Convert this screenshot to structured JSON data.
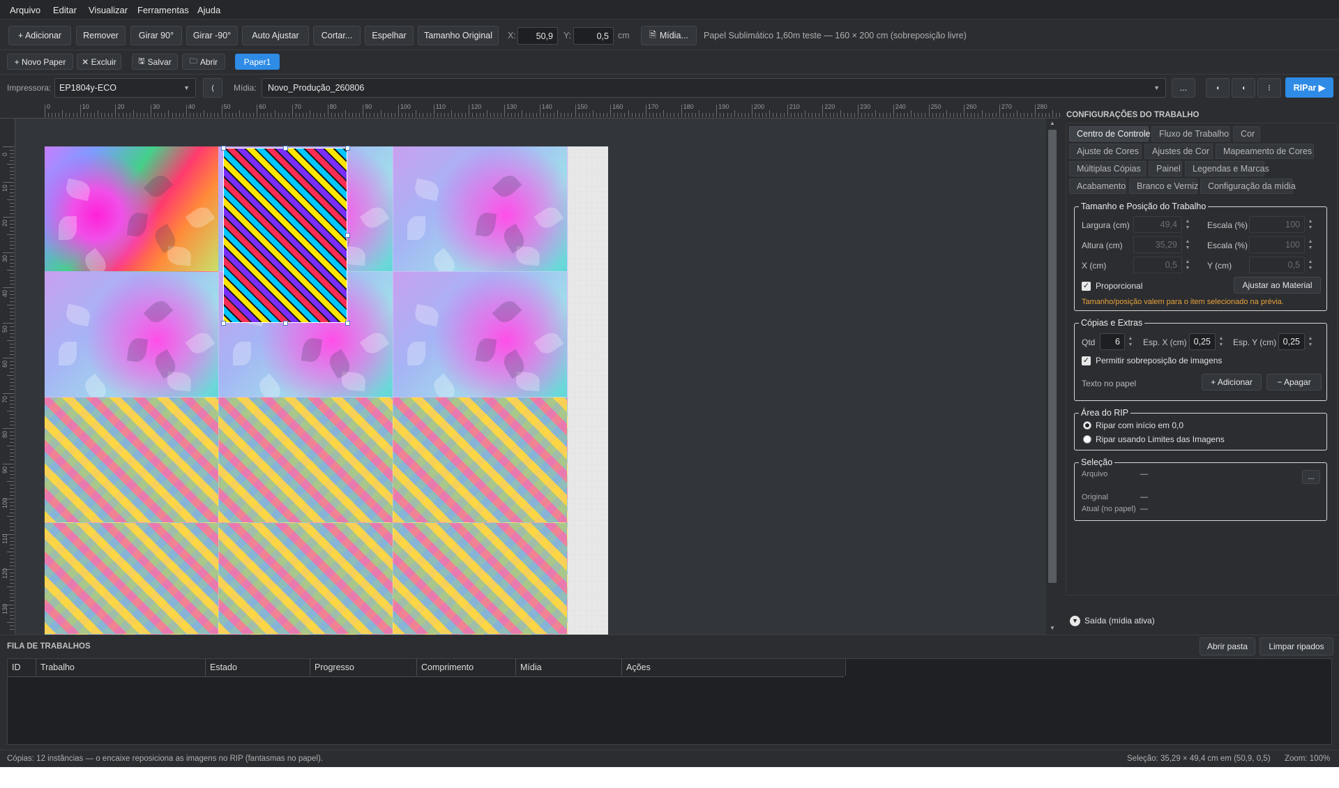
{
  "menu": [
    "Arquivo",
    "Editar",
    "Visualizar",
    "Ferramentas",
    "Ajuda"
  ],
  "toolbar": {
    "add": "+ Adicionar",
    "remove": "Remover",
    "rot90": "Girar 90°",
    "rotm90": "Girar -90°",
    "autofit": "Auto Ajustar",
    "cut": "Cortar...",
    "mirror": "Espelhar",
    "original": "Tamanho Original",
    "x_label": "X:",
    "x_value": "50,9",
    "y_label": "Y:",
    "y_value": "0,5",
    "unit": "cm",
    "media_btn": "Mídia...",
    "info": "Papel Sublimático 1,60m teste — 160 × 200 cm  (sobreposição livre)"
  },
  "papers": {
    "new": "+ Novo Paper",
    "delete": "✕ Excluir",
    "save": "Salvar",
    "open": "Abrir",
    "tab": "Paper1"
  },
  "printer": {
    "label": "Impressora:",
    "value": "EP1804y-ECO",
    "media_label": "Mídia:",
    "media_value": "Novo_Produção_260806",
    "more": "...",
    "rip": "RIPar ▶"
  },
  "ruler": {
    "unit": "cm",
    "h": [
      "0",
      "10",
      "20",
      "30",
      "40",
      "50",
      "60",
      "70",
      "80",
      "90",
      "100",
      "110",
      "120",
      "130",
      "140",
      "150",
      "160",
      "170",
      "180",
      "190",
      "200",
      "210",
      "220",
      "230",
      "240",
      "250",
      "260",
      "270",
      "280"
    ],
    "v": [
      "0",
      "10",
      "20",
      "30",
      "40",
      "50",
      "60",
      "70",
      "80",
      "90",
      "100",
      "110",
      "120",
      "130"
    ]
  },
  "panel": {
    "title": "CONFIGURAÇÕES DO TRABALHO",
    "tabs_row1": [
      "Centro de Controle",
      "Fluxo de Trabalho",
      "Cor"
    ],
    "tabs_row2": [
      "Ajuste de Cores",
      "Ajustes de Cor",
      "Mapeamento de Cores"
    ],
    "tabs_row3": [
      "Múltiplas Cópias",
      "Painel",
      "Legendas e Marcas"
    ],
    "tabs_row4": [
      "Acabamento",
      "Branco e Verniz",
      "Configuração da mídia"
    ],
    "size": {
      "title": "Tamanho e Posição do Trabalho",
      "width_label": "Largura (cm)",
      "width": "49,4",
      "height_label": "Altura (cm)",
      "height": "35,29",
      "x_label": "X (cm)",
      "x": "0,5",
      "scale_label": "Escala (%)",
      "scale1": "100",
      "scale2": "100",
      "y_label": "Y (cm)",
      "y": "0,5",
      "proportional": "Proporcional",
      "fit": "Ajustar ao Material",
      "warning": "Tamanho/posição valem para o item selecionado na prévia."
    },
    "copies": {
      "title": "Cópias e Extras",
      "qty_label": "Qtd",
      "qty": "6",
      "espx_label": "Esp. X (cm)",
      "espx": "0,25",
      "espy_label": "Esp. Y (cm)",
      "espy": "0,25",
      "overlap": "Permitir sobreposição de imagens",
      "text_label": "Texto no papel",
      "add": "+ Adicionar",
      "erase": "− Apagar"
    },
    "rip": {
      "title": "Área do RIP",
      "opt1": "Ripar com início em 0,0",
      "opt2": "Ripar usando Limites das Imagens"
    },
    "selection": {
      "title": "Seleção",
      "file_label": "Arquivo",
      "file": "—",
      "browse": "...",
      "orig_label": "Original",
      "orig": "—",
      "cur_label": "Atual (no papel)",
      "cur": "—"
    },
    "output": "Saída (mídia ativa)"
  },
  "queue": {
    "title": "FILA DE TRABALHOS",
    "open_folder": "Abrir pasta",
    "clear": "Limpar ripados",
    "columns": [
      "ID",
      "Trabalho",
      "Estado",
      "Progresso",
      "Comprimento",
      "Mídia",
      "Ações"
    ]
  },
  "status": {
    "left": "Cópias: 12 instâncias — o encaixe reposiciona as imagens no RIP (fantasmas no papel).",
    "selection": "Seleção: 35,29 × 49,4 cm em (50,9, 0,5)",
    "zoom": "Zoom: 100%"
  },
  "colors": {
    "accent": "#2e8be6",
    "warning": "#e8a33a",
    "bg": "#2b2d31"
  },
  "icons": [
    "file-icon",
    "save-icon",
    "folder-icon",
    "chevron-down-icon",
    "chevron-left-icon",
    "checkbox-icon",
    "expand-icon"
  ]
}
